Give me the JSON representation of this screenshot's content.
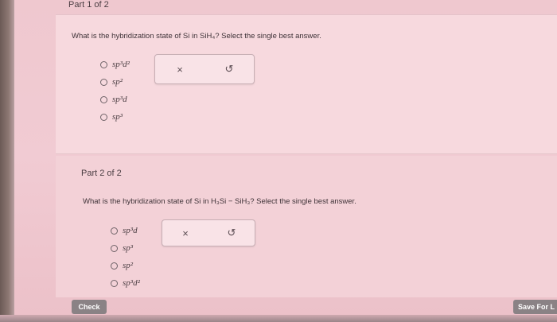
{
  "part1": {
    "label": "Part 1 of 2",
    "question": "What is the hybridization state of Si in SiH₄? Select the single best answer.",
    "options": [
      "sp³d²",
      "sp²",
      "sp³d",
      "sp³"
    ]
  },
  "part2": {
    "label": "Part 2 of 2",
    "question": "What is the hybridization state of Si in H₃Si − SiH₃? Select the single best answer.",
    "options": [
      "sp³d",
      "sp³",
      "sp²",
      "sp³d²"
    ]
  },
  "tools": {
    "clear_icon": "×",
    "undo_icon": "↺"
  },
  "buttons": {
    "check": "Check",
    "save": "Save For L"
  },
  "colors": {
    "page_bg": "#efc8cf",
    "card_bg": "#f7d9de",
    "button_bg": "#8a8285"
  }
}
